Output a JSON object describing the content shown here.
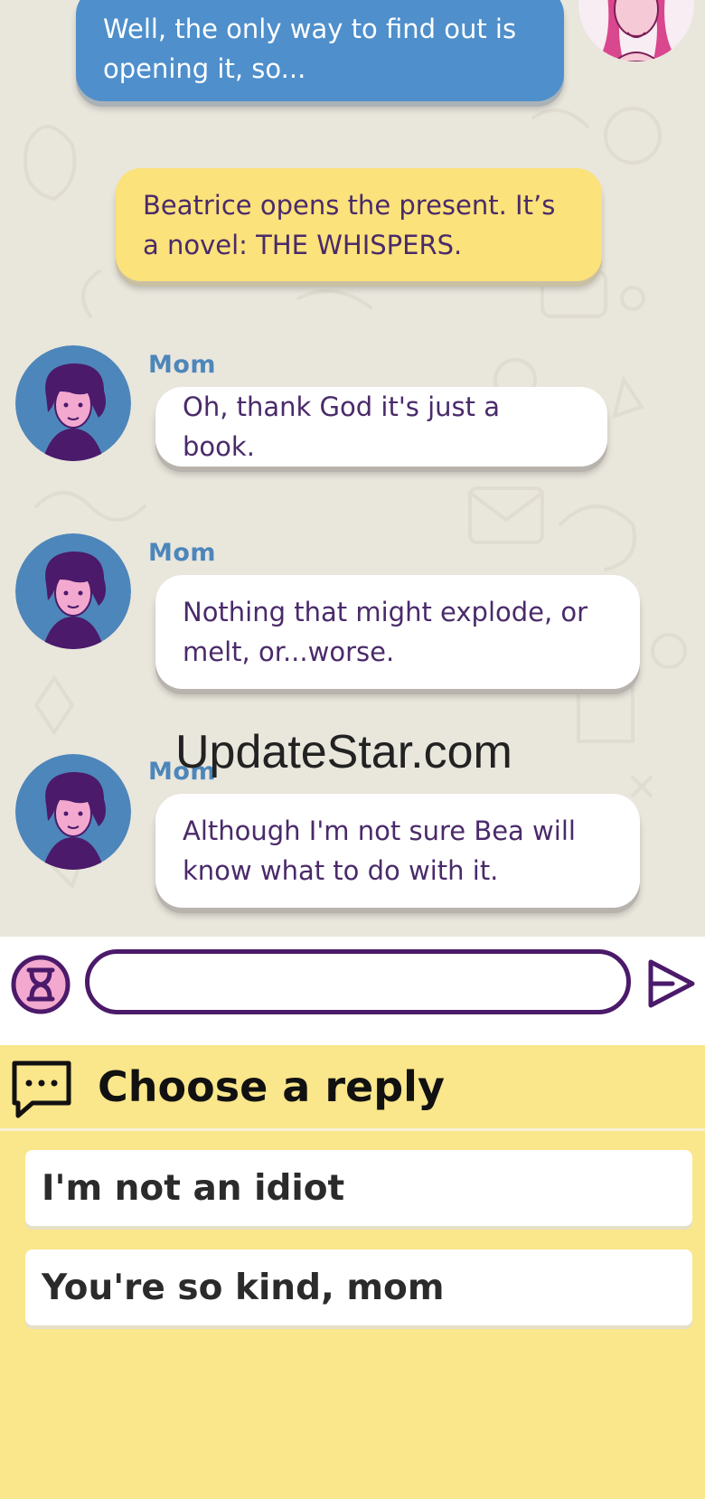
{
  "chat": {
    "messages": [
      {
        "type": "me",
        "text": "Well, the only way to find out is opening it, so..."
      },
      {
        "type": "narration",
        "text": "Beatrice opens the present. It’s a novel: THE WHISPERS."
      },
      {
        "type": "mom",
        "sender": "Mom",
        "text": "Oh, thank God it's just a book."
      },
      {
        "type": "mom",
        "sender": "Mom",
        "text": "Nothing that might explode, or melt, or...worse."
      },
      {
        "type": "mom",
        "sender": "Mom",
        "text": "Although I'm not sure Bea will know what to do with it."
      }
    ]
  },
  "input": {
    "value": "",
    "timer_icon": "hourglass-icon",
    "send_icon": "send-arrow-icon"
  },
  "replies": {
    "header_icon": "speech-bubble-icon",
    "title": "Choose a reply",
    "options": [
      {
        "label": "I'm not an idiot"
      },
      {
        "label": "You're so kind, mom"
      }
    ]
  },
  "watermark": "UpdateStar.com",
  "colors": {
    "chat_background": "#e9e6dc",
    "my_bubble": "#4f8fcb",
    "narration_bubble": "#fbe27a",
    "mom_bubble": "#ffffff",
    "sender_name": "#4d86ba",
    "ink": "#4b1a6a",
    "reply_panel": "#fae68b"
  }
}
